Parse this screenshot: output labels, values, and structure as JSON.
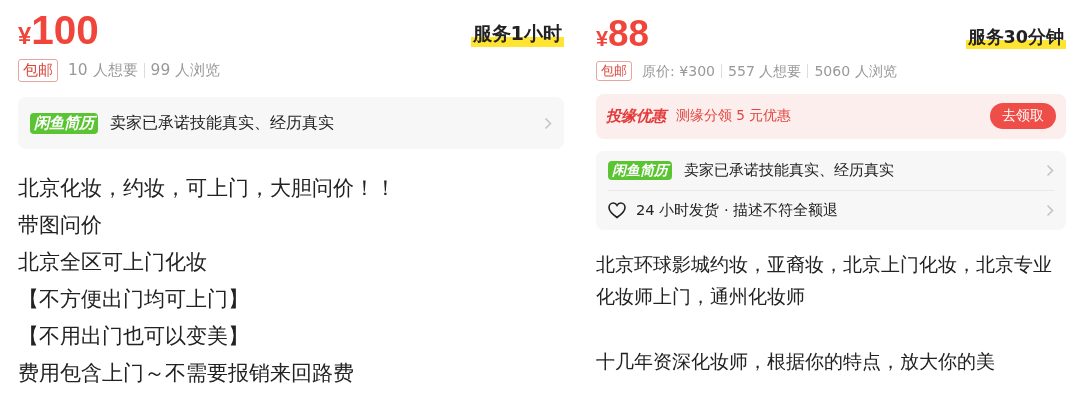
{
  "listings": [
    {
      "price_symbol": "¥",
      "price": "100",
      "service_tag": "服务1小时",
      "shipping_tag": "包邮",
      "stats": [
        "10 人想要",
        "99 人浏览"
      ],
      "info_rows": [
        {
          "kind": "resume",
          "badge": "闲鱼简历",
          "text": "卖家已承诺技能真实、经历真实"
        }
      ],
      "description": [
        "北京化妆，约妆，可上门，大胆问价！！",
        "带图问价",
        "北京全区可上门化妆",
        "【不方便出门均可上门】",
        "【不用出门也可以变美】",
        "费用包含上门～不需要报销来回路费"
      ]
    },
    {
      "price_symbol": "¥",
      "price": "88",
      "service_tag": "服务30分钟",
      "shipping_tag": "包邮",
      "stats": [
        "原价: ¥300",
        "557 人想要",
        "5060 人浏览"
      ],
      "promo": {
        "title": "投缘优惠",
        "text": "测缘分领 5 元优惠",
        "button": "去领取"
      },
      "info_rows": [
        {
          "kind": "resume",
          "badge": "闲鱼简历",
          "text": "卖家已承诺技能真实、经历真实"
        },
        {
          "kind": "guarantee",
          "text": "24 小时发货 · 描述不符全额退"
        }
      ],
      "description": [
        "北京环球影城约妆，亚裔妆，北京上门化妆，北京专业化妆师上门，通州化妆师",
        "十几年资深化妆师，根据你的特点，放大你的美"
      ]
    }
  ]
}
